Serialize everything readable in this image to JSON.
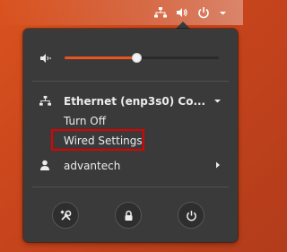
{
  "tray": {
    "network_icon": "network-wired-icon",
    "volume_icon": "volume-icon",
    "power_icon": "power-icon",
    "dropdown_icon": "chevron-down-icon"
  },
  "volume": {
    "icon": "volume-icon",
    "level": 0.47
  },
  "network": {
    "icon": "network-wired-icon",
    "label": "Ethernet (enp3s0) Co...",
    "items": [
      {
        "label": "Turn Off"
      },
      {
        "label": "Wired Settings"
      }
    ]
  },
  "user": {
    "icon": "user-icon",
    "label": "advantech"
  },
  "actions": [
    {
      "name": "settings-button",
      "icon": "settings-tools-icon"
    },
    {
      "name": "lock-button",
      "icon": "lock-icon"
    },
    {
      "name": "power-off-button",
      "icon": "power-icon"
    }
  ],
  "colors": {
    "accent": "#e95420",
    "menu_bg": "#3a3a3a",
    "highlight": "#e00000"
  }
}
